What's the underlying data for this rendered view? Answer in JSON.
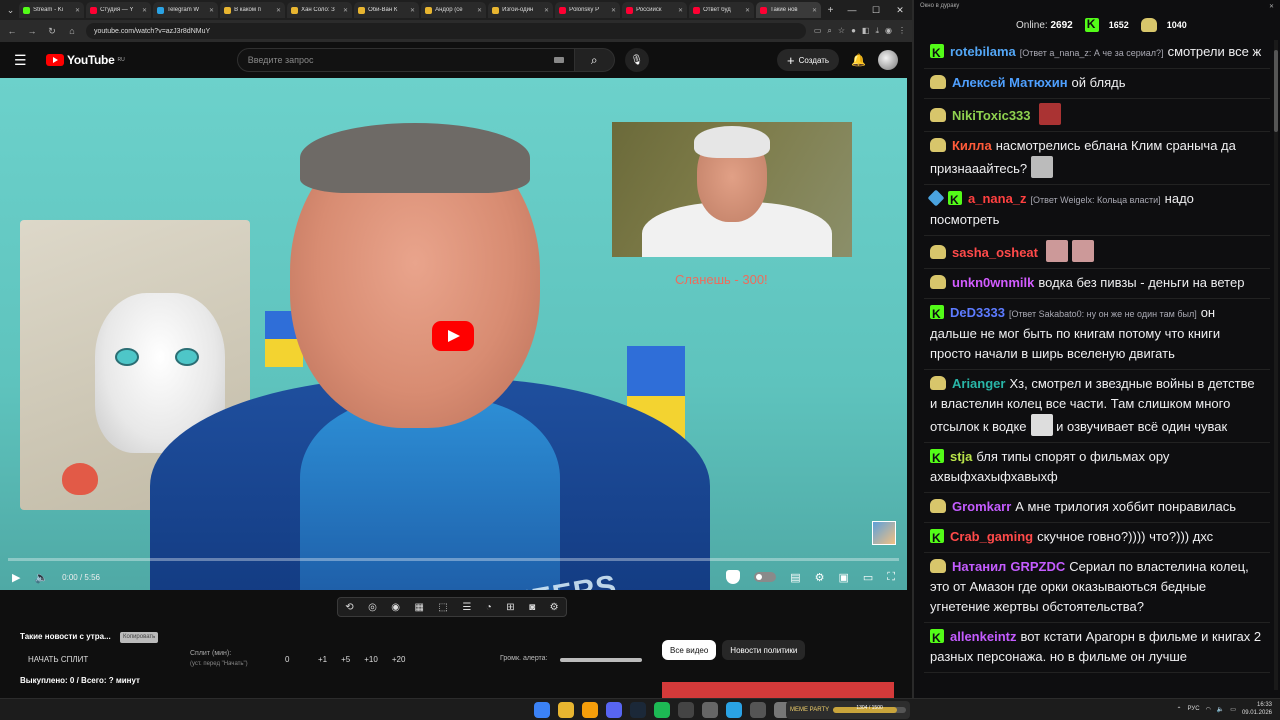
{
  "browser": {
    "tabs": [
      {
        "label": "Stream - Ki",
        "color": "#53fc18"
      },
      {
        "label": "Студия — Y",
        "color": "#ff0033"
      },
      {
        "label": "Telegram W",
        "color": "#2aa3e4"
      },
      {
        "label": "В каком п",
        "color": "#e8b530"
      },
      {
        "label": "Хан Соло: З",
        "color": "#e8b530"
      },
      {
        "label": "Оби-Ван К",
        "color": "#e8b530"
      },
      {
        "label": "Андор (се",
        "color": "#e8b530"
      },
      {
        "label": "Изгой-один",
        "color": "#e8b530"
      },
      {
        "label": "Polonsky P",
        "color": "#ff0033"
      },
      {
        "label": "Российск",
        "color": "#ff0033"
      },
      {
        "label": "Ответ буд",
        "color": "#ff0033"
      },
      {
        "label": "Такие нов",
        "color": "#ff0033",
        "active": true
      }
    ],
    "url": "youtube.com/watch?v=azJ3r8dNMuY"
  },
  "youtube": {
    "logo": "YouTube",
    "region": "RU",
    "search_placeholder": "Введите запрос",
    "create_label": "Создать"
  },
  "video": {
    "overlay_text": "Сланешь - 300!",
    "jersey_text": "PIONEERS",
    "time": "0:00 / 5:56",
    "progress_fraction": 0
  },
  "below": {
    "title": "Такие новости с утра...",
    "tag": "Копировать",
    "split_start": "НАЧАТЬ СПЛИТ",
    "split_label": "Сплит (мин):",
    "split_hint": "(уст. перед \"Начать\")",
    "split_zero": "0",
    "split_incs": [
      "+1",
      "+5",
      "+10",
      "+20"
    ],
    "volume_label": "Громк. алерта:",
    "bought": "Выкуплено: 0 / Всего: ? минут",
    "chips": [
      "Все видео",
      "Новости политики"
    ]
  },
  "chat": {
    "window_title": "Окно в дураку",
    "online_label": "Online:",
    "online_value": "2692",
    "kick_count": "1652",
    "duck_count": "1040",
    "messages": [
      {
        "badge": "k",
        "nick": "rotebilama",
        "color": "#53a6f5",
        "reply": "[Ответ a_nana_z: А че за сериал?]",
        "text": "смотрели все ж"
      },
      {
        "badge": "duck",
        "nick": "Алексей Матюхин",
        "color": "#4fa0ff",
        "text": "ой блядь"
      },
      {
        "badge": "duck",
        "nick": "NikiToxic333",
        "color": "#8fd14f",
        "text": "",
        "emote": "#a33"
      },
      {
        "badge": "duck",
        "nick": "Килла",
        "color": "#ff5b3a",
        "text": "насмотрелись еблана Клим сраныча да признааайтесь?",
        "emote": "#bbb"
      },
      {
        "badge": "pen-k",
        "nick": "a_nana_z",
        "color": "#ff4040",
        "reply": "[Ответ Weigelx: Кольца власти]",
        "text": "надо посмотреть"
      },
      {
        "badge": "duck",
        "nick": "sasha_osheat",
        "color": "#ff4a4a",
        "text": "",
        "emote": "#c99",
        "emote2": "#c99"
      },
      {
        "badge": "duck",
        "nick": "unkn0wnmilk",
        "color": "#d25cff",
        "text": "водка без пивзы - деньги на ветер"
      },
      {
        "badge": "k",
        "nick": "DeD3333",
        "color": "#5d7bff",
        "reply": "[Ответ Sakabato0: ну он же не один там был]",
        "text": "он дальше не мог быть по книгам потому что книги просто начали в ширь вселеную двигать"
      },
      {
        "badge": "duck",
        "nick": "Arianger",
        "color": "#29b6a8",
        "text": "Хз, смотрел и звездные войны в детстве и властелин колец все части. Там слишком много отсылок к водке",
        "text2": "и озвучивает всё один чувак",
        "emote": "#ddd"
      },
      {
        "badge": "k",
        "nick": "stja",
        "color": "#b9e34a",
        "text": "бля типы спорят о фильмах ору ахвыфхахыфхавыхф"
      },
      {
        "badge": "duck",
        "nick": "Gromkarr",
        "color": "#c45cff",
        "text": "А мне трилогия хоббит понравилась"
      },
      {
        "badge": "k",
        "nick": "Crab_gaming",
        "color": "#ff4a4a",
        "text": "скучное говно?)))) что?))) дхс"
      },
      {
        "badge": "duck",
        "nick": "Натанил",
        "color": "#c45cff",
        "nick2": "GRPZDC",
        "color2": "#c45cff",
        "text": "Сериал по властелина колец, это от Амазон где орки оказываються бедные угнетение жертвы обстоятельства?"
      },
      {
        "badge": "k",
        "nick": "allenkeintz",
        "color": "#c45cff",
        "text": "вот кстати Арагорн в фильме и книгах 2 разных персонажа. но в фильме он лучше"
      }
    ]
  },
  "taskbar": {
    "meme_title": "MEME PARTY",
    "meme_count": "1304 / 1500",
    "meme_fraction": 0.87,
    "lang": "РУС",
    "time": "16:33",
    "date": "09.01.2026"
  }
}
